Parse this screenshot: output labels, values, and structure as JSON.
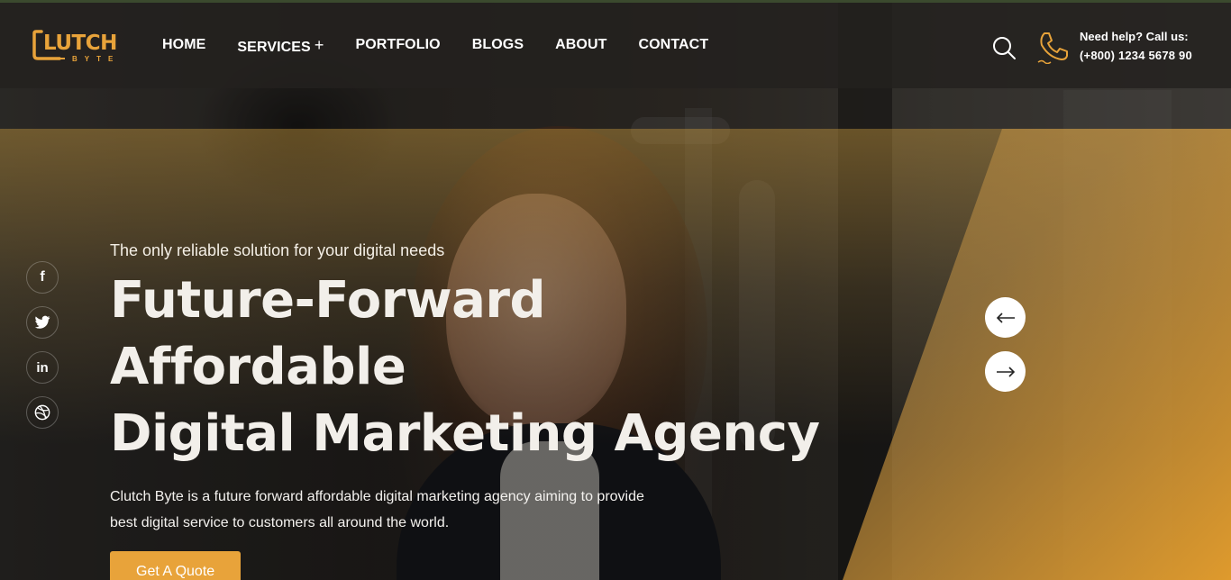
{
  "brand": {
    "logo_text": "LUTCH",
    "logo_sub": "BYTE",
    "accent_color": "#e8a33a"
  },
  "nav": {
    "items": [
      {
        "label": "HOME",
        "has_submenu": false
      },
      {
        "label": "SERVICES",
        "has_submenu": true,
        "submenu_icon": "+"
      },
      {
        "label": "PORTFOLIO",
        "has_submenu": false
      },
      {
        "label": "BLOGS",
        "has_submenu": false
      },
      {
        "label": "ABOUT",
        "has_submenu": false
      },
      {
        "label": "CONTACT",
        "has_submenu": false
      }
    ]
  },
  "header": {
    "search_icon": "search-icon",
    "help_label": "Need help? Call us:",
    "phone": "(+800) 1234 5678 90"
  },
  "social": [
    {
      "name": "facebook",
      "glyph": "f"
    },
    {
      "name": "twitter",
      "glyph": "twitter"
    },
    {
      "name": "linkedin",
      "glyph": "in"
    },
    {
      "name": "dribbble",
      "glyph": "dribbble"
    }
  ],
  "hero": {
    "tagline": "The only reliable solution for your digital needs",
    "title_line1": "Future-Forward Affordable",
    "title_line2": "Digital Marketing Agency",
    "description_line1": "Clutch Byte is a future forward affordable digital marketing agency aiming to provide",
    "description_line2": "best digital service to customers all around the world.",
    "cta_label": "Get A Quote"
  },
  "slider": {
    "prev_icon": "←",
    "next_icon": "→"
  }
}
